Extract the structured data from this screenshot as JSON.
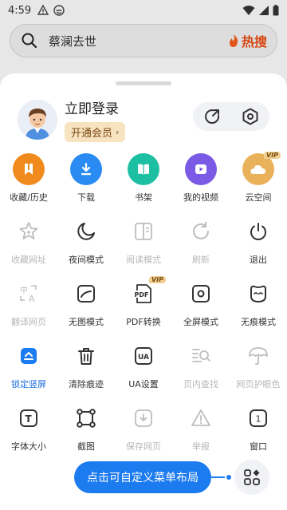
{
  "status_bar": {
    "time": "4:59"
  },
  "search": {
    "query": "蔡澜去世",
    "hot_label": "热搜"
  },
  "profile": {
    "login_text": "立即登录",
    "vip_text": "开通会员",
    "vip_arrow": "›"
  },
  "menu": {
    "rows": [
      [
        {
          "label": "收藏/历史",
          "icon": "bookmark-icon",
          "color": "#f08a1c"
        },
        {
          "label": "下载",
          "icon": "download-icon",
          "color": "#2a8cf2"
        },
        {
          "label": "书架",
          "icon": "book-icon",
          "color": "#1dbfa2"
        },
        {
          "label": "我的视频",
          "icon": "play-icon",
          "color": "#7b5ae6"
        },
        {
          "label": "云空间",
          "icon": "cloud-icon",
          "color": "#e9b25a",
          "badge": "VIP"
        }
      ],
      [
        {
          "label": "收藏网址",
          "icon": "star-add-icon",
          "state": "disabled"
        },
        {
          "label": "夜间模式",
          "icon": "moon-icon"
        },
        {
          "label": "阅读模式",
          "icon": "reader-icon",
          "state": "disabled"
        },
        {
          "label": "刷新",
          "icon": "refresh-icon",
          "state": "disabled"
        },
        {
          "label": "退出",
          "icon": "power-icon"
        }
      ],
      [
        {
          "label": "翻译网页",
          "icon": "translate-icon",
          "state": "disabled"
        },
        {
          "label": "无图模式",
          "icon": "no-image-icon"
        },
        {
          "label": "PDF转换",
          "icon": "pdf-icon",
          "badge": "VIP",
          "pdf_text": "PDF"
        },
        {
          "label": "全屏模式",
          "icon": "fullscreen-icon"
        },
        {
          "label": "无痕模式",
          "icon": "incognito-icon"
        }
      ],
      [
        {
          "label": "锁定竖屏",
          "icon": "lock-portrait-icon",
          "state": "active"
        },
        {
          "label": "清除痕迹",
          "icon": "trash-icon"
        },
        {
          "label": "UA设置",
          "icon": "ua-icon",
          "ua_text": "UA"
        },
        {
          "label": "页内查找",
          "icon": "find-in-page-icon",
          "state": "disabled"
        },
        {
          "label": "网页护眼色",
          "icon": "umbrella-icon",
          "state": "disabled"
        }
      ],
      [
        {
          "label": "字体大小",
          "icon": "font-size-icon",
          "font_text": "T"
        },
        {
          "label": "截图",
          "icon": "screenshot-icon"
        },
        {
          "label": "保存网页",
          "icon": "save-page-icon",
          "state": "disabled"
        },
        {
          "label": "举报",
          "icon": "report-icon",
          "state": "disabled"
        },
        {
          "label": "窗口",
          "icon": "window-icon",
          "window_count": "1"
        }
      ]
    ]
  },
  "customize_button": {
    "label": "点击可自定义菜单布局"
  },
  "colors": {
    "accent": "#1d7bf0",
    "disabled": "#b8b8b8",
    "text": "#333333"
  }
}
